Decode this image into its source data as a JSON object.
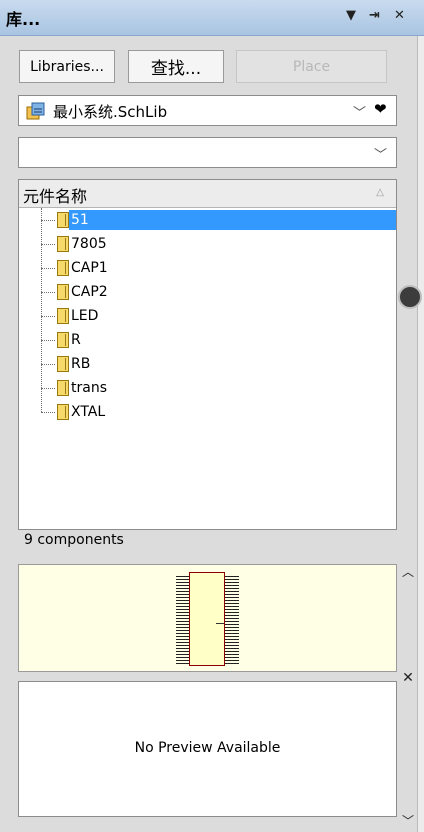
{
  "panel": {
    "title": "库...",
    "icons": [
      "dropdown-icon",
      "pin-icon",
      "close-icon"
    ]
  },
  "toolbar": {
    "libraries_label": "Libraries...",
    "search_label": "查找...",
    "place_label": "Place"
  },
  "library_selector": {
    "selected": "最小系统.SchLib",
    "icon": "schlib-icon"
  },
  "filter": {
    "value": ""
  },
  "list": {
    "column_header": "元件名称",
    "items": [
      {
        "label": "51",
        "selected": true
      },
      {
        "label": "7805"
      },
      {
        "label": "CAP1"
      },
      {
        "label": "CAP2"
      },
      {
        "label": "LED"
      },
      {
        "label": "R"
      },
      {
        "label": "RB"
      },
      {
        "label": "trans"
      },
      {
        "label": "XTAL"
      }
    ]
  },
  "status": {
    "count": "9 components"
  },
  "preview": {
    "no_preview": "No Preview Available"
  },
  "colors": {
    "selection": "#3399ff",
    "symbol_bg": "#ffffe6",
    "titlebar": "#b6cfe9"
  }
}
